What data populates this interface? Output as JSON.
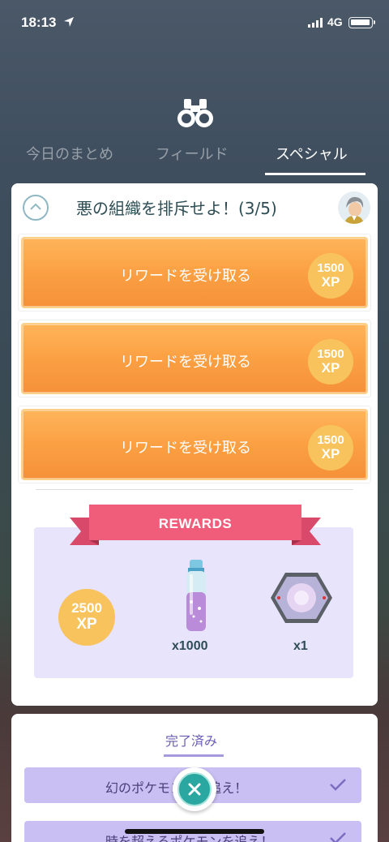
{
  "status_bar": {
    "time": "18:13",
    "network": "4G"
  },
  "tabs": [
    {
      "label": "今日のまとめ",
      "active": false
    },
    {
      "label": "フィールド",
      "active": false
    },
    {
      "label": "スペシャル",
      "active": true
    }
  ],
  "quest": {
    "title": "悪の組織を排斥せよ！(3/5)",
    "rewards": [
      {
        "label": "リワードを受け取る",
        "xp_value": "1500",
        "xp_unit": "XP"
      },
      {
        "label": "リワードを受け取る",
        "xp_value": "1500",
        "xp_unit": "XP"
      },
      {
        "label": "リワードを受け取る",
        "xp_value": "1500",
        "xp_unit": "XP"
      }
    ],
    "rewards_panel": {
      "ribbon": "REWARDS",
      "items": [
        {
          "icon": "xp-coin-icon",
          "value": "2500",
          "unit": "XP"
        },
        {
          "icon": "stardust-vial-icon",
          "count": "x1000"
        },
        {
          "icon": "incense-icon",
          "count": "x1"
        }
      ]
    }
  },
  "completed": {
    "tab_label": "完了済み",
    "items": [
      {
        "label": "幻のポケモン...を追え！"
      },
      {
        "label": "時を超えるポケモンを追え！"
      }
    ]
  },
  "colors": {
    "orange": "#fba043",
    "xp_gold": "#f8c35c",
    "teal": "#2aa7a0",
    "lavender": "#e8e4fb",
    "ribbon": "#ef5d7b"
  }
}
